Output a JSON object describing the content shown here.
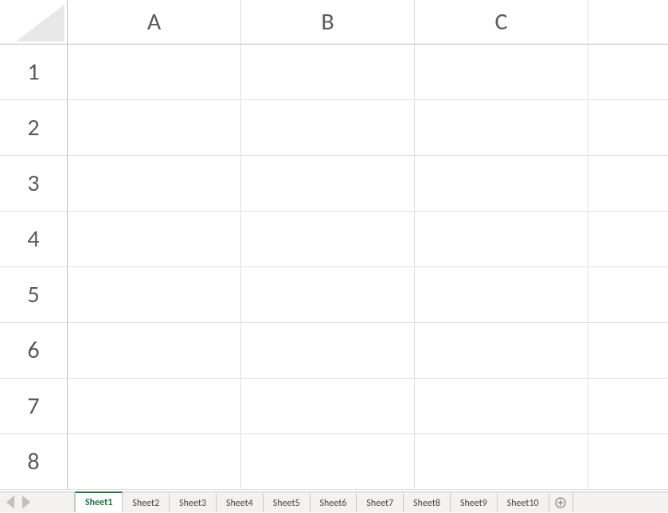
{
  "columns": [
    "A",
    "B",
    "C",
    ""
  ],
  "rows": [
    "1",
    "2",
    "3",
    "4",
    "5",
    "6",
    "7",
    "8"
  ],
  "cells": [
    [
      "",
      "",
      "",
      ""
    ],
    [
      "",
      "",
      "",
      ""
    ],
    [
      "",
      "",
      "",
      ""
    ],
    [
      "",
      "",
      "",
      ""
    ],
    [
      "",
      "",
      "",
      ""
    ],
    [
      "",
      "",
      "",
      ""
    ],
    [
      "",
      "",
      "",
      ""
    ],
    [
      "",
      "",
      "",
      ""
    ]
  ],
  "sheets": {
    "active": 0,
    "tabs": [
      {
        "label": "Sheet1"
      },
      {
        "label": "Sheet2"
      },
      {
        "label": "Sheet3"
      },
      {
        "label": "Sheet4"
      },
      {
        "label": "Sheet5"
      },
      {
        "label": "Sheet6"
      },
      {
        "label": "Sheet7"
      },
      {
        "label": "Sheet8"
      },
      {
        "label": "Sheet9"
      },
      {
        "label": "Sheet10"
      }
    ]
  }
}
